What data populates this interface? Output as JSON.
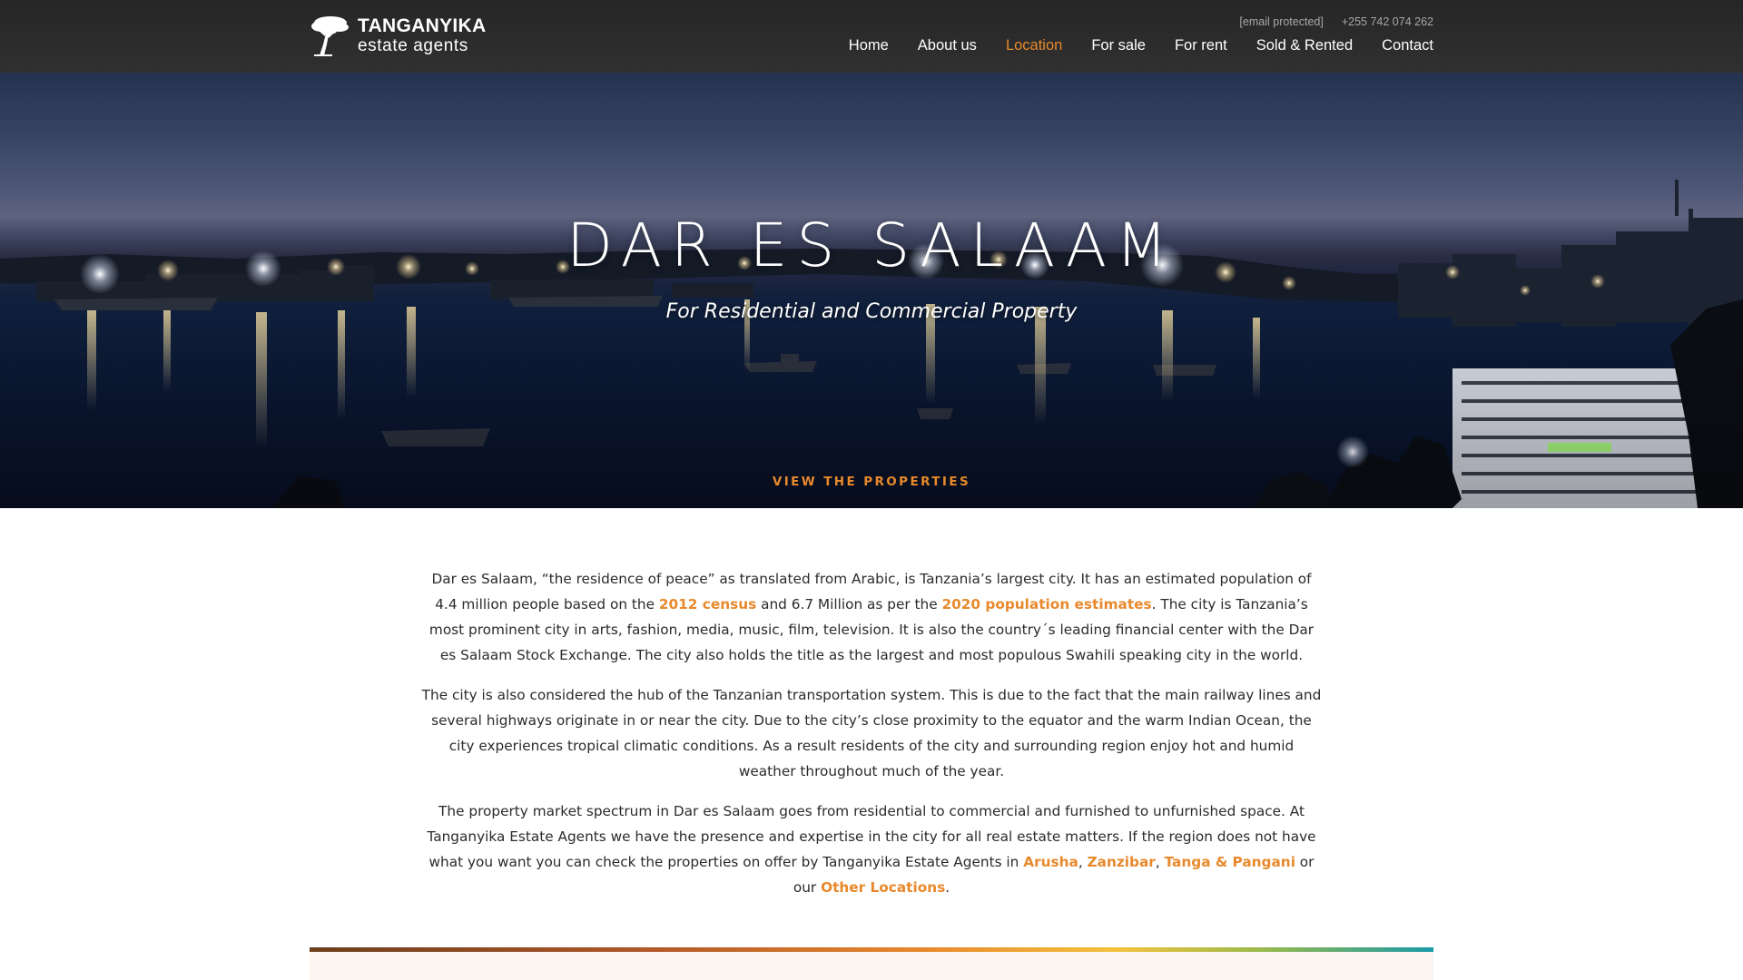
{
  "brand": {
    "name": "TANGANYIKA",
    "tagline": "estate agents"
  },
  "contact": {
    "email": "[email protected]",
    "phone": "+255 742 074 262"
  },
  "nav": {
    "items": [
      {
        "label": "Home"
      },
      {
        "label": "About us"
      },
      {
        "label": "Location",
        "active": true
      },
      {
        "label": "For sale"
      },
      {
        "label": "For rent"
      },
      {
        "label": "Sold & Rented"
      },
      {
        "label": "Contact"
      }
    ]
  },
  "hero": {
    "title": "DAR ES SALAAM",
    "subtitle": "For Residential and Commercial Property",
    "cta": "VIEW THE PROPERTIES"
  },
  "content": {
    "p1": {
      "a": "Dar es Salaam, “the residence of peace” as translated from Arabic, is Tanzania’s largest city. It has an estimated population of 4.4 million people based on the ",
      "link1": "2012 census",
      "b": " and 6.7 Million as per the ",
      "link2": "2020 population estimates",
      "c": ". The city is Tanzania’s most prominent city in arts, fashion, media, music, film, television. It is also the country´s leading financial center with the Dar es Salaam Stock Exchange. The city also holds the title as the largest and most populous Swahili speaking city in the world."
    },
    "p2": "The city is also considered the hub of the Tanzanian transportation system. This is due to the fact that the main railway lines and several highways originate in or near the city. Due to the city’s close proximity to the equator and the warm Indian Ocean, the city experiences tropical climatic conditions. As a result residents of the city and surrounding region enjoy hot and humid weather throughout much of the year.",
    "p3": {
      "a": "The property market spectrum in Dar es Salaam goes from residential to commercial and furnished to unfurnished space. At Tanganyika Estate Agents we have the presence and expertise in the city for all real estate matters. If the region does not have what you want you can check the properties on offer by Tanganyika Estate Agents in ",
      "link_arusha": "Arusha",
      "sep1": ", ",
      "link_zanzibar": "Zanzibar",
      "sep2": ", ",
      "link_tanga": "Tanga & Pangani",
      "mid": " or our ",
      "link_other": "Other Locations",
      "end": "."
    }
  },
  "colors": {
    "accent": "#e8892c",
    "header_bg": "#2b2b2b",
    "text": "#2b2b2b"
  },
  "icons": {
    "logo": "acacia-tree-icon"
  }
}
